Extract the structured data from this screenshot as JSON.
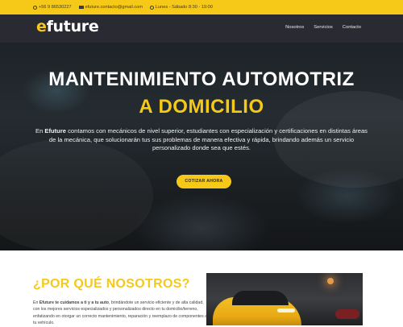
{
  "topbar": {
    "phone": "+56 9 86530227",
    "email": "efuture.contacto@gmail.com",
    "hours": "Lunes - Sábado 8:30 - 19:00"
  },
  "nav": {
    "logo_e": "e",
    "logo_rest": "future",
    "links": [
      "Nosotros",
      "Servicios",
      "Contacto"
    ]
  },
  "hero": {
    "title_line1": "MANTENIMIENTO AUTOMOTRIZ",
    "title_line2": "A DOMICILIO",
    "text_prefix": "En ",
    "text_brand": "Efuture",
    "text_body": " contamos con mecánicos de nivel superior, estudiantes con especialización y certificaciones en distintas áreas de la mecánica, que solucionarán tus sus problemas de manera efectiva y rápida, brindando además un servicio personalizado donde sea que estés.",
    "cta": "COTIZAR AHORA"
  },
  "why": {
    "title": "¿POR QUÉ NOSOTROS?",
    "text_prefix": "En ",
    "text_bold": "Efuture te cuidamos a ti y a tu auto",
    "text_body": ", brindándote un servicio eficiente y de alta calidad, con los mejores servicios especializados y personalizados directo en tu domicilio/terreno, enfatizando en otorgar un correcto mantenimiento, reparación y reemplazo de componentes a tu vehículo."
  },
  "colors": {
    "accent": "#f6c918",
    "nav_bg": "#2a2a33"
  }
}
